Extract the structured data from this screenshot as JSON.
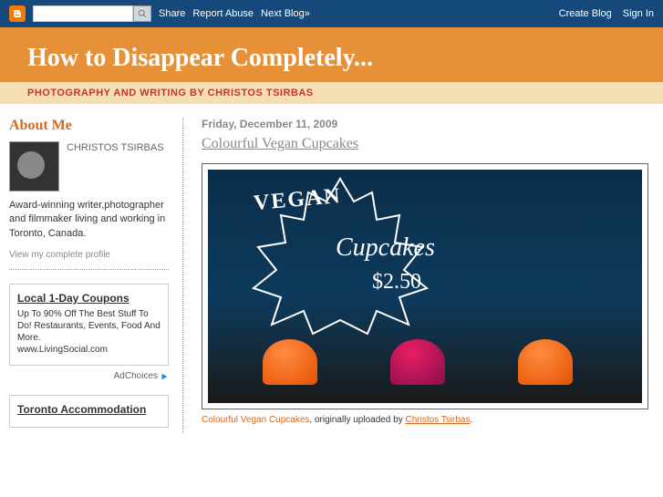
{
  "navbar": {
    "share": "Share",
    "report": "Report Abuse",
    "next": "Next Blog»",
    "create": "Create Blog",
    "signin": "Sign In"
  },
  "header": {
    "title": "How to Disappear Completely...",
    "subtitle": "PHOTOGRAPHY AND WRITING BY CHRISTOS TSIRBAS"
  },
  "sidebar": {
    "about_title": "About Me",
    "profile_name": "CHRISTOS TSIRBAS",
    "profile_bio": "Award-winning writer,photographer and filmmaker living and working in Toronto, Canada.",
    "profile_link": "View my complete profile",
    "ad1_title": "Local 1-Day Coupons",
    "ad1_text": "Up To 90% Off The Best Stuff To Do! Restaurants, Events, Food And More.",
    "ad1_url": "www.LivingSocial.com",
    "adchoices": "AdChoices",
    "ad2_title": "Toronto Accommodation"
  },
  "post": {
    "date": "Friday, December 11, 2009",
    "title": "Colourful Vegan Cupcakes",
    "image_text1": "VEGAN",
    "image_text2": "Cupcakes",
    "image_text3": "$2.50",
    "caption_link": "Colourful Vegan Cupcakes",
    "caption_mid": ", originally uploaded by ",
    "caption_author": "Christos Tsirbas",
    "caption_end": "."
  }
}
